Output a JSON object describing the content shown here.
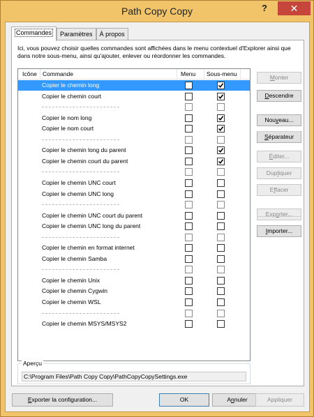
{
  "window": {
    "title": "Path Copy Copy",
    "help_glyph": "?",
    "close_glyph": "✕"
  },
  "tabs": [
    {
      "label": "Commandes",
      "active": true
    },
    {
      "label": "Paramètres",
      "active": false
    },
    {
      "label": "À propos",
      "active": false
    }
  ],
  "description": "Ici, vous pouvez choisir quelles commandes sont affichées dans le menu contextuel d'Explorer ainsi que dans notre sous-menu, ainsi qu'ajouter, enlever ou réordonner les commandes.",
  "list": {
    "columns": {
      "icon": "Icône",
      "command": "Commande",
      "menu": "Menu",
      "submenu": "Sous-menu"
    },
    "rows": [
      {
        "type": "cmd",
        "name": "Copier le chemin long",
        "menu": false,
        "submenu": true,
        "selected": true
      },
      {
        "type": "cmd",
        "name": "Copier le chemin court",
        "menu": false,
        "submenu": true
      },
      {
        "type": "sep"
      },
      {
        "type": "cmd",
        "name": "Copier le nom long",
        "menu": false,
        "submenu": true
      },
      {
        "type": "cmd",
        "name": "Copier le nom court",
        "menu": false,
        "submenu": true
      },
      {
        "type": "sep"
      },
      {
        "type": "cmd",
        "name": "Copier le chemin long du parent",
        "menu": false,
        "submenu": true
      },
      {
        "type": "cmd",
        "name": "Copier le chemin court du parent",
        "menu": false,
        "submenu": true
      },
      {
        "type": "sep"
      },
      {
        "type": "cmd",
        "name": "Copier le chemin UNC court",
        "menu": false,
        "submenu": false
      },
      {
        "type": "cmd",
        "name": "Copier le chemin UNC long",
        "menu": false,
        "submenu": false
      },
      {
        "type": "sep"
      },
      {
        "type": "cmd",
        "name": "Copier le chemin UNC court du parent",
        "menu": false,
        "submenu": false
      },
      {
        "type": "cmd",
        "name": "Copier le chemin UNC long du parent",
        "menu": false,
        "submenu": false
      },
      {
        "type": "sep"
      },
      {
        "type": "cmd",
        "name": "Copier le chemin en format internet",
        "menu": false,
        "submenu": false
      },
      {
        "type": "cmd",
        "name": "Copier le chemin Samba",
        "menu": false,
        "submenu": false
      },
      {
        "type": "sep"
      },
      {
        "type": "cmd",
        "name": "Copier le chemin Unix",
        "menu": false,
        "submenu": false
      },
      {
        "type": "cmd",
        "name": "Copier le chemin Cygwin",
        "menu": false,
        "submenu": false
      },
      {
        "type": "cmd",
        "name": "Copier le chemin WSL",
        "menu": false,
        "submenu": false
      },
      {
        "type": "sep"
      },
      {
        "type": "cmd",
        "name": "Copier le chemin MSYS/MSYS2",
        "menu": false,
        "submenu": false
      }
    ]
  },
  "side_buttons": [
    {
      "id": "monter",
      "label": "Monter",
      "enabled": false
    },
    {
      "id": "descendre",
      "label": "Descendre",
      "enabled": true
    },
    {
      "id": "nouveau",
      "label": "Nouveau...",
      "enabled": true
    },
    {
      "id": "separateur",
      "label": "Séparateur",
      "enabled": true
    },
    {
      "id": "editer",
      "label": "Éditer...",
      "enabled": false
    },
    {
      "id": "dupliquer",
      "label": "Dupliquer",
      "enabled": false
    },
    {
      "id": "effacer",
      "label": "Effacer",
      "enabled": false
    },
    {
      "id": "exporter",
      "label": "Exporter...",
      "enabled": false
    },
    {
      "id": "importer",
      "label": "Importer...",
      "enabled": true
    }
  ],
  "preview": {
    "label": "Aperçu",
    "value": "C:\\Program Files\\Path Copy Copy\\PathCopyCopySettings.exe"
  },
  "footer": {
    "export_config": "Exporter la configuration...",
    "ok": "OK",
    "cancel": "Annuler",
    "apply": "Appliquer"
  },
  "colors": {
    "titlebar": "#eab44a",
    "close": "#c7463c",
    "selection": "#3399ff"
  }
}
